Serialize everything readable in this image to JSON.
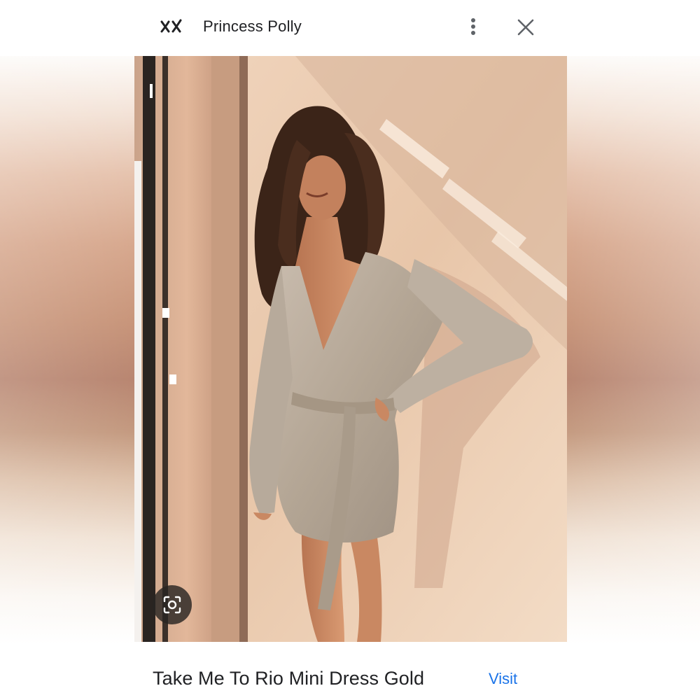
{
  "header": {
    "source_logo_icon": "xx-logo-icon",
    "source_name": "Princess Polly",
    "more_icon": "more-vert-icon",
    "close_icon": "close-icon"
  },
  "image": {
    "lens_icon": "lens-search-icon"
  },
  "footer": {
    "product_title": "Take Me To Rio Mini Dress Gold",
    "visit_label": "Visit"
  },
  "colors": {
    "text_primary": "#202124",
    "link": "#1a73e8",
    "icon_gray": "#5f6368"
  }
}
